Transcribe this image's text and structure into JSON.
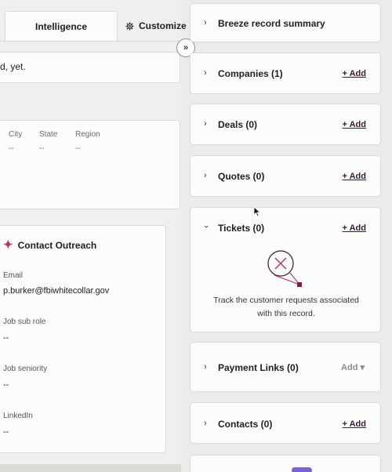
{
  "tabs": {
    "intelligence_label": "Intelligence",
    "customize_label": "Customize"
  },
  "notice": {
    "text": "d, yet."
  },
  "address": {
    "columns": [
      {
        "label": "City",
        "value": "--"
      },
      {
        "label": "State",
        "value": "--"
      },
      {
        "label": "Region",
        "value": "--"
      }
    ]
  },
  "outreach": {
    "title": "Contact Outreach",
    "fields": [
      {
        "label": "Email",
        "value": "p.burker@fbiwhitecollar.gov"
      },
      {
        "label": "Job sub role",
        "value": "--"
      },
      {
        "label": "Job seniority",
        "value": "--"
      },
      {
        "label": "LinkedIn",
        "value": "--"
      }
    ]
  },
  "expand_button": {
    "glyph": "»"
  },
  "sidebar": {
    "cards": [
      {
        "title": "Breeze record summary",
        "add": ""
      },
      {
        "title": "Companies (1)",
        "add": "+ Add"
      },
      {
        "title": "Deals (0)",
        "add": "+ Add"
      },
      {
        "title": "Quotes (0)",
        "add": "+ Add"
      },
      {
        "title": "Tickets (0)",
        "add": "+ Add"
      },
      {
        "title": "Payment Links (0)",
        "add": "Add ▾"
      },
      {
        "title": "Contacts (0)",
        "add": "+ Add"
      }
    ],
    "tickets_empty_line1": "Track the customer requests associated",
    "tickets_empty_line2": "with this record."
  },
  "colors": {
    "accent": "#b0366e",
    "add_link": "#3b1b2f",
    "badge": "#7b61d6"
  },
  "icons": [
    "gear-icon",
    "sparkle-icon",
    "chevron-right-icon",
    "chevron-down-icon",
    "double-chevron-right-icon",
    "ticket-empty-illustration",
    "mouse-cursor"
  ]
}
